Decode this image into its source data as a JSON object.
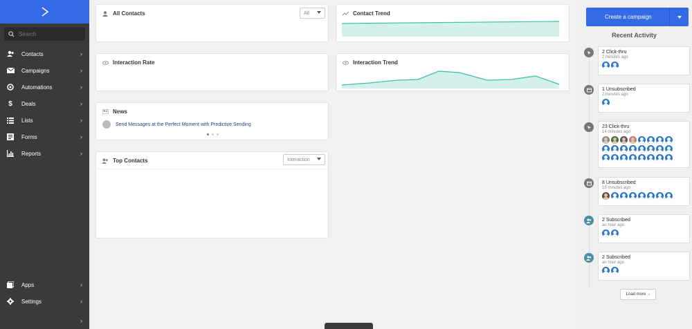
{
  "sidebar": {
    "search_placeholder": "Search",
    "items": [
      {
        "label": "Contacts"
      },
      {
        "label": "Campaigns"
      },
      {
        "label": "Automations"
      },
      {
        "label": "Deals"
      },
      {
        "label": "Lists"
      },
      {
        "label": "Forms"
      },
      {
        "label": "Reports"
      }
    ],
    "bottom_items": [
      {
        "label": "Apps"
      },
      {
        "label": "Settings"
      }
    ]
  },
  "cards": {
    "all_contacts": {
      "title": "All Contacts",
      "filter_value": "All"
    },
    "contact_trend": {
      "title": "Contact Trend"
    },
    "interaction_rate": {
      "title": "Interaction Rate"
    },
    "interaction_trend": {
      "title": "Interaction Trend"
    },
    "news": {
      "title": "News",
      "headline": "Send Messages at the Perfect Moment with Predictive Sending"
    },
    "top_contacts": {
      "title": "Top Contacts",
      "filter_value": "Interaction"
    }
  },
  "right_panel": {
    "create_button": "Create a campaign",
    "title": "Recent Activity",
    "activities": [
      {
        "title": "2 Click-thru",
        "time": "2 minutes ago",
        "type": "click"
      },
      {
        "title": "1 Unsubscribed",
        "time": "2 minutes ago",
        "type": "unsub"
      },
      {
        "title": "23 Click-thru",
        "time": "14 minutes ago",
        "type": "click"
      },
      {
        "title": "8 Unsubscribed",
        "time": "15 minutes ago",
        "type": "unsub"
      },
      {
        "title": "2 Subscribed",
        "time": "an hour ago",
        "type": "sub"
      },
      {
        "title": "2 Subscribed",
        "time": "an hour ago",
        "type": "sub"
      }
    ],
    "load_more": "Load more"
  },
  "colors": {
    "brand": "#356ae6",
    "sidebar": "#3a3a3a",
    "trend_fill": "#d3f1ea",
    "trend_line": "#3cc2a8",
    "avatar": "#2d79c7",
    "subscribed_icon": "#4a8fa0",
    "neutral_icon": "#777777"
  }
}
